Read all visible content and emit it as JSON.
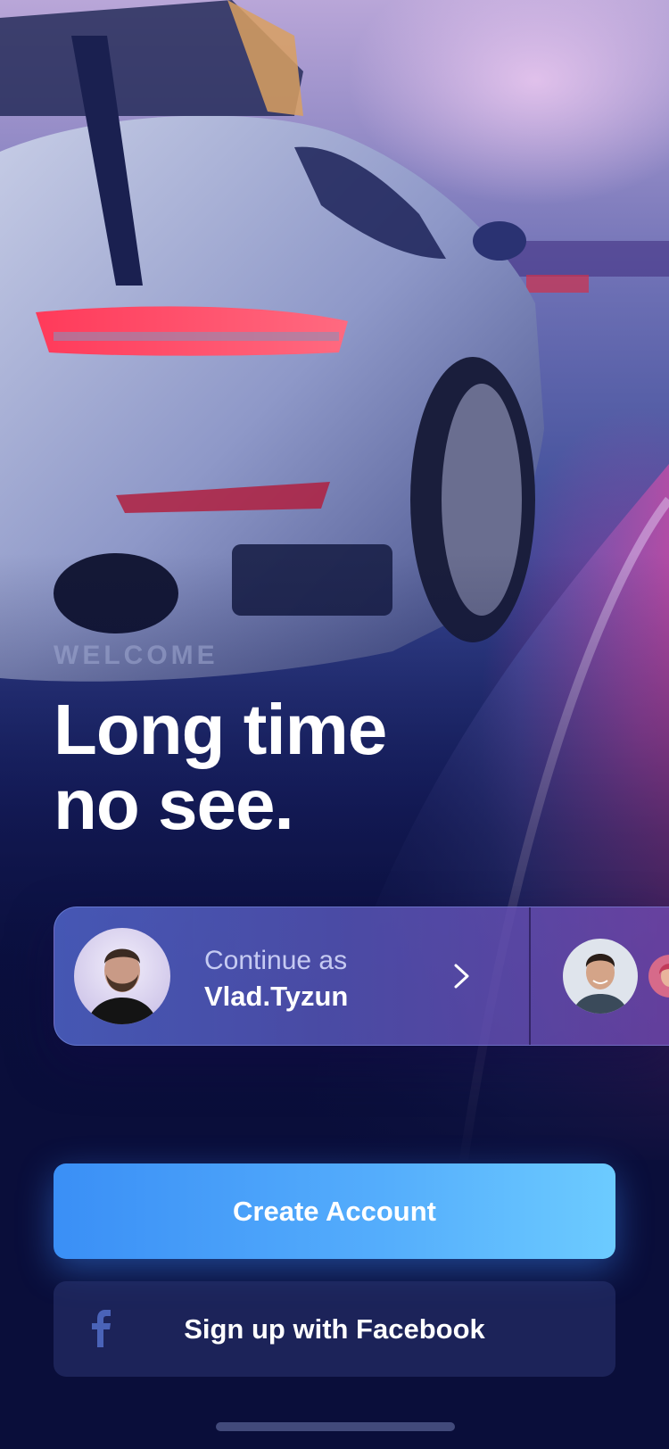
{
  "hero": {
    "eyebrow": "WELCOME",
    "headline_line1": "Long time",
    "headline_line2": "no see."
  },
  "account_card": {
    "continue_label": "Continue as",
    "username": "Vlad.Tyzun"
  },
  "actions": {
    "create_account_label": "Create Account",
    "facebook_label": "Sign up with Facebook"
  },
  "colors": {
    "background": "#0a0e3a",
    "primary_button_start": "#3a8ff6",
    "primary_button_end": "#6ccbff",
    "facebook_icon": "#4a63b8"
  },
  "icons": {
    "chevron": "chevron-right-icon",
    "facebook": "facebook-icon"
  }
}
